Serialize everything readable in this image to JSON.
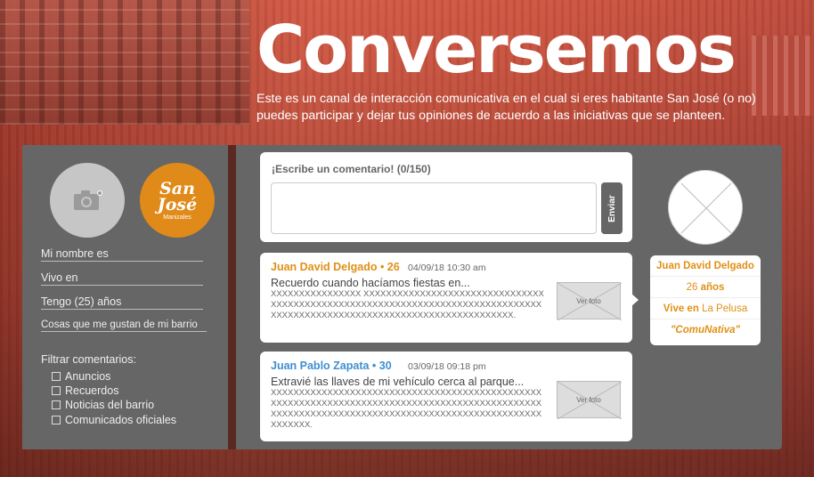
{
  "header": {
    "title": "Conversemos",
    "subtitle": "Este es un canal de interacción comunicativa en el cual si eres habitante San José (o no) puedes participar y dejar tus opiniones de acuerdo a las iniciativas que se planteen."
  },
  "sidebar": {
    "logo_top": "San",
    "logo_mid": "José",
    "logo_sub": "Manizales",
    "fields": {
      "name": "Mi nombre es",
      "lives": "Vivo en",
      "age": "Tengo (25) años",
      "likes": "Cosas que me gustan de mi barrio"
    },
    "filter_title": "Filtrar comentarios:",
    "filters": [
      "Anuncios",
      "Recuerdos",
      "Noticias del barrio",
      "Comunicados oficiales"
    ]
  },
  "composer": {
    "label": "¡Escribe un comentario! (0/150)",
    "send_label": "Enviar"
  },
  "comments": [
    {
      "name": "Juan David Delgado • 26",
      "date": "04/09/18 10:30 am",
      "lead": "Recuerdo cuando hacíamos fiestas en...",
      "body": "XXXXXXXXXXXXXXXX XXXXXXXXXXXXXXXXXXXXXXXXXXXXXXXXXXXXXXXXXXXXXXXXXXXXXXXXXXXXXXXXXXXXXXXXXXXXXXXXXXXXXXXXXXXXXXXXXXXXXXXXXXXXXXXXXXXXXXXXXXX.",
      "photo": "Ver foto",
      "color": "#e09016"
    },
    {
      "name": "Juan Pablo Zapata • 30",
      "date": "03/09/18 09:18 pm",
      "lead": "Extravié las llaves de mi vehículo cerca al parque...",
      "body": "XXXXXXXXXXXXXXXXXXXXXXXXXXXXXXXXXXXXXXXXXXXXXXXXXXXXXXXXXXXXXXXXXXXXXXXXXXXXXXXXXXXXXXXXXXXXXXXXXXXXXXXXXXXXXXXXXXXXXXXXXXXXXXXXXXXXXXXXXXXXXXXXXXXXXXX.",
      "photo": "Ver foto",
      "color": "#3f8fd2"
    }
  ],
  "profile": {
    "name": "Juan David Delgado",
    "age_num": "26",
    "age_unit": "años",
    "lives_label": "Vive en",
    "lives_value": "La Pelusa",
    "tag": "\"ComuNativa\""
  },
  "colors": {
    "accent_orange": "#e09016",
    "accent_blue": "#3f8fd2",
    "panel": "#666666"
  }
}
